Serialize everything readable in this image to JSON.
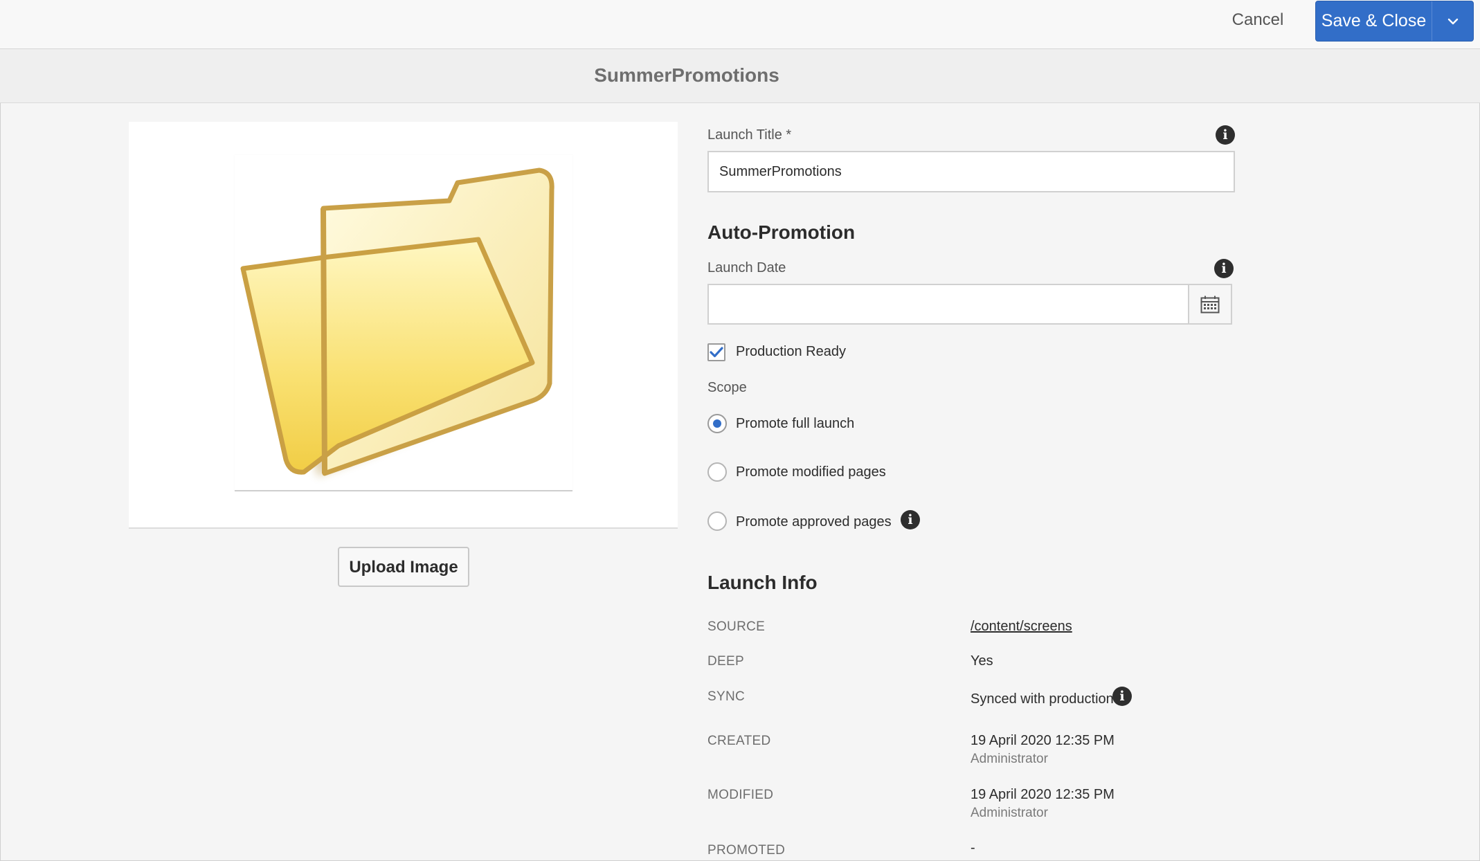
{
  "toolbar": {
    "cancel_label": "Cancel",
    "save_label": "Save & Close"
  },
  "page": {
    "title": "SummerPromotions"
  },
  "thumbnail": {
    "icon": "folder-icon",
    "upload_label": "Upload Image"
  },
  "form": {
    "launch_title_label": "Launch Title *",
    "launch_title_value": "SummerPromotions",
    "auto_promotion_heading": "Auto-Promotion",
    "launch_date_label": "Launch Date",
    "launch_date_value": "",
    "production_ready_label": "Production Ready",
    "production_ready_checked": true,
    "scope_label": "Scope",
    "scope_options": [
      {
        "label": "Promote full launch",
        "selected": true
      },
      {
        "label": "Promote modified pages",
        "selected": false
      },
      {
        "label": "Promote approved pages",
        "selected": false
      }
    ]
  },
  "launch_info": {
    "heading": "Launch Info",
    "rows": [
      {
        "key": "SOURCE",
        "value": "/content/screens"
      },
      {
        "key": "DEEP",
        "value": "Yes"
      },
      {
        "key": "SYNC",
        "value": "Synced with production"
      },
      {
        "key": "CREATED",
        "value": "19 April 2020 12:35 PM",
        "sub": "Administrator"
      },
      {
        "key": "MODIFIED",
        "value": "19 April 2020 12:35 PM",
        "sub": "Administrator"
      },
      {
        "key": "PROMOTED",
        "value": "-"
      }
    ]
  },
  "colors": {
    "accent": "#326ec8",
    "background": "#f5f5f5"
  }
}
